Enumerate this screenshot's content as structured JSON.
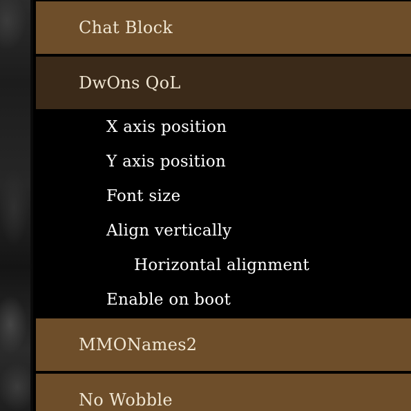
{
  "menu": {
    "categories": [
      {
        "label": "Chat Block"
      },
      {
        "label": "DwOns QoL",
        "settings": [
          {
            "label": "X axis position"
          },
          {
            "label": "Y axis position"
          },
          {
            "label": "Font size"
          },
          {
            "label": "Align vertically"
          },
          {
            "label": "Horizontal alignment"
          },
          {
            "label": "Enable on boot"
          }
        ]
      },
      {
        "label": "MMONames2"
      },
      {
        "label": "No Wobble"
      }
    ]
  },
  "colors": {
    "category_background": "#6e4e2a",
    "active_category_background": "#3b2a19",
    "settings_background": "#000000",
    "text": "#f0e6d2"
  }
}
